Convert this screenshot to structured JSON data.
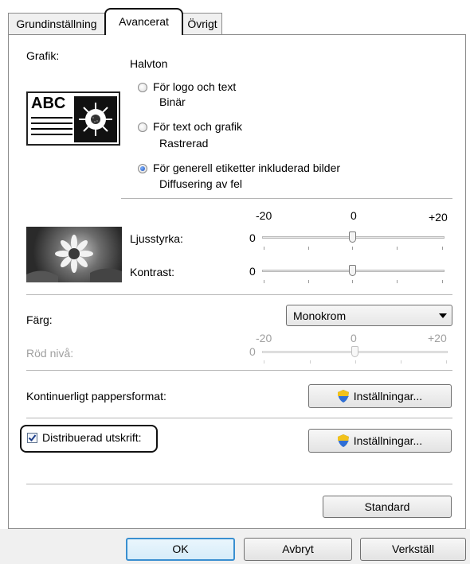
{
  "tabs": [
    {
      "label": "Grundinställning"
    },
    {
      "label": "Avancerat"
    },
    {
      "label": "Övrigt"
    }
  ],
  "graphics": {
    "label": "Grafik:",
    "preview_text": "ABC",
    "halftone_label": "Halvton",
    "options": [
      {
        "label": "För logo och text",
        "sub": "Binär",
        "selected": false
      },
      {
        "label": "För text och grafik",
        "sub": "Rastrerad",
        "selected": false
      },
      {
        "label": "För generell etiketter inkluderad bilder",
        "sub": "Diffusering av fel",
        "selected": true
      }
    ]
  },
  "adjust": {
    "scale_min": "-20",
    "scale_mid": "0",
    "scale_max": "+20",
    "brightness_label": "Ljusstyrka:",
    "brightness_value": "0",
    "contrast_label": "Kontrast:",
    "contrast_value": "0"
  },
  "color": {
    "label": "Färg:",
    "selected": "Monokrom",
    "red_level_label": "Röd nivå:",
    "red_value": "0",
    "scale_min": "-20",
    "scale_mid": "0",
    "scale_max": "+20"
  },
  "continuous": {
    "label": "Kontinuerligt pappersformat:",
    "button": "Inställningar..."
  },
  "distributed": {
    "label": "Distribuerad utskrift:",
    "checked": true,
    "button": "Inställningar..."
  },
  "standard_button": "Standard",
  "footer": {
    "ok": "OK",
    "cancel": "Avbryt",
    "apply": "Verkställ"
  },
  "colors": {
    "accent": "#3a8fd0",
    "highlight_border": "#111111"
  }
}
